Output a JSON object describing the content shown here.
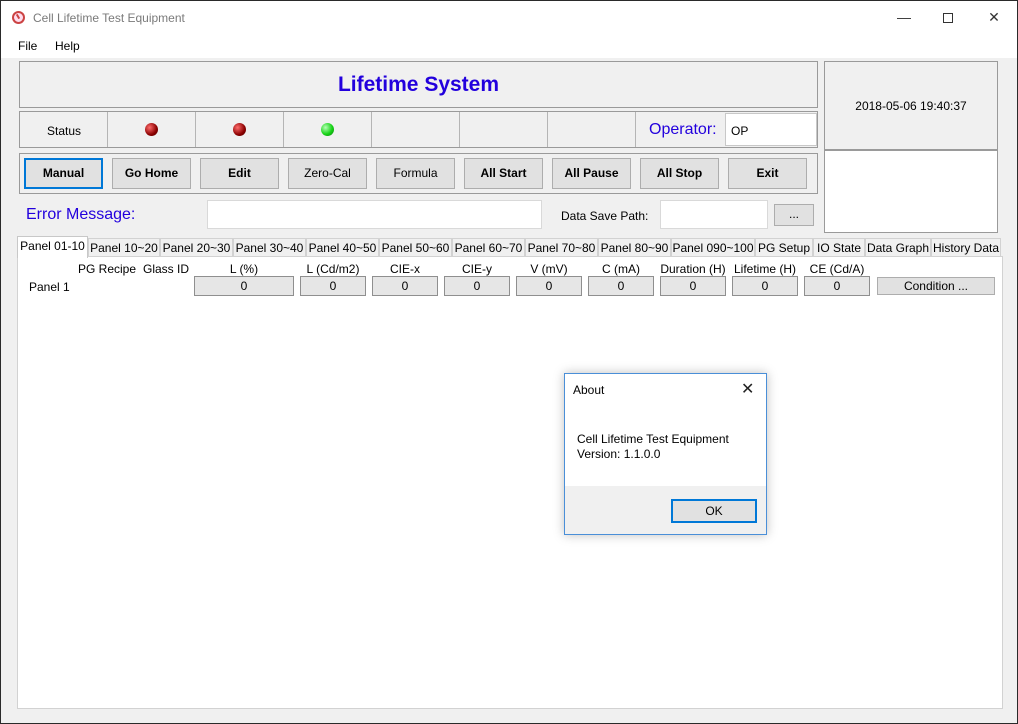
{
  "window": {
    "title": "Cell Lifetime Test Equipment"
  },
  "menu": {
    "file": "File",
    "help": "Help"
  },
  "banner": {
    "title": "Lifetime System"
  },
  "clock": {
    "datetime": "2018-05-06 19:40:37"
  },
  "status": {
    "label": "Status",
    "leds": [
      "red",
      "red",
      "green"
    ],
    "operator_label": "Operator:",
    "operator_value": "OP"
  },
  "buttons": {
    "manual": "Manual",
    "go_home": "Go Home",
    "edit": "Edit",
    "zero_cal": "Zero-Cal",
    "formula": "Formula",
    "all_start": "All Start",
    "all_pause": "All Pause",
    "all_stop": "All Stop",
    "exit": "Exit"
  },
  "error": {
    "label": "Error Message:",
    "value": ""
  },
  "save_path": {
    "label": "Data Save Path:",
    "value": "",
    "browse_label": "..."
  },
  "tabs": [
    "Panel 01-10",
    "Panel 10~20",
    "Panel 20~30",
    "Panel 30~40",
    "Panel 40~50",
    "Panel 50~60",
    "Panel 60~70",
    "Panel 70~80",
    "Panel 80~90",
    "Panel 090~100",
    "PG Setup",
    "IO State",
    "Data Graph",
    "History Data"
  ],
  "selected_tab": "Panel 01-10",
  "table": {
    "headers": {
      "pg_recipe": "PG Recipe",
      "glass_id": "Glass ID",
      "l_pct": "L (%)",
      "l_cd": "L (Cd/m2)",
      "ciex": "CIE-x",
      "ciey": "CIE-y",
      "v": "V (mV)",
      "c": "C (mA)",
      "duration": "Duration (H)",
      "lifetime": "Lifetime (H)",
      "ce": "CE (Cd/A)"
    },
    "rows": [
      {
        "label": "Panel 1",
        "l_pct": "0",
        "l_cd": "0",
        "ciex": "0",
        "ciey": "0",
        "v": "0",
        "c": "0",
        "duration": "0",
        "lifetime": "0",
        "ce": "0",
        "condition_label": "Condition ..."
      }
    ]
  },
  "dialog": {
    "title": "About",
    "line1": "Cell Lifetime Test Equipment",
    "line2": "Version: 1.1.0.0",
    "ok_label": "OK"
  },
  "colors": {
    "accent_text": "#2200dd",
    "focus_border": "#0078d7",
    "led_red": "#8a0000",
    "led_green": "#17d417"
  }
}
